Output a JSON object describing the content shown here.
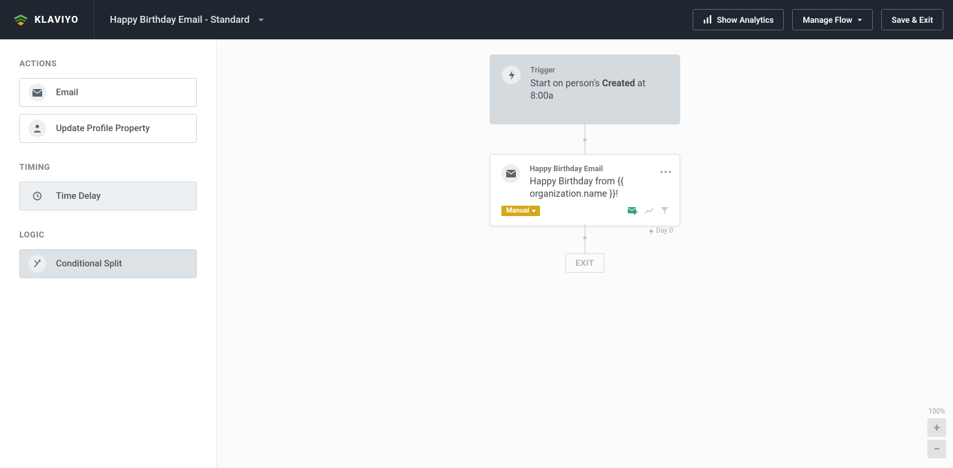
{
  "brand": "KLAVIYO",
  "header": {
    "title": "Happy Birthday Email - Standard",
    "show_analytics": "Show Analytics",
    "manage_flow": "Manage Flow",
    "save_exit": "Save & Exit"
  },
  "sidebar": {
    "sections": [
      {
        "label": "ACTIONS",
        "items": [
          {
            "icon": "mail-icon",
            "label": "Email"
          },
          {
            "icon": "person-icon",
            "label": "Update Profile Property"
          }
        ]
      },
      {
        "label": "TIMING",
        "items": [
          {
            "icon": "clock-icon",
            "label": "Time Delay"
          }
        ]
      },
      {
        "label": "LOGIC",
        "items": [
          {
            "icon": "split-icon",
            "label": "Conditional Split"
          }
        ]
      }
    ]
  },
  "flow": {
    "trigger": {
      "label": "Trigger",
      "prefix": "Start on person's ",
      "strong": "Created",
      "suffix": " at 8:00a"
    },
    "email": {
      "label": "Happy Birthday Email",
      "subject": "Happy Birthday from {{ organization.name }}!",
      "status": "Manual",
      "day_tag": "Day 0"
    },
    "exit": "EXIT"
  },
  "zoom": {
    "level": "100%",
    "plus": "+",
    "minus": "−"
  }
}
